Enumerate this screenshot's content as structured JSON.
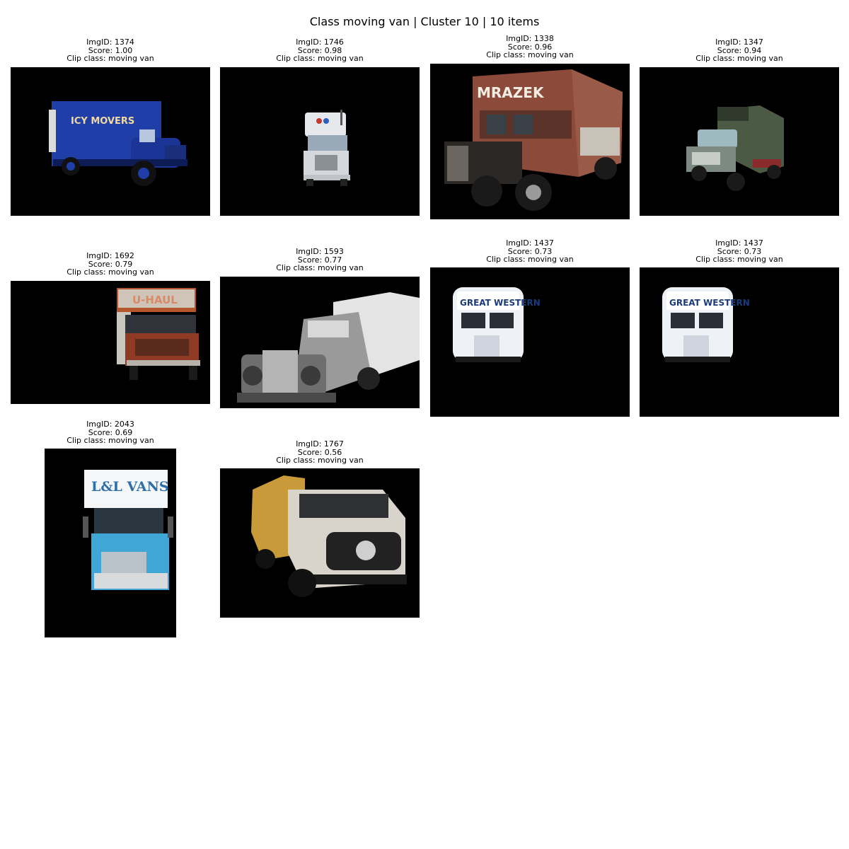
{
  "title": "Class moving van | Cluster 10 | 10 items",
  "items": [
    {
      "id_line": "ImgID: 1374",
      "score_line": "Score: 1.00",
      "class_line": "Clip class: moving van",
      "picture": "blue-moving-truck",
      "truck_text": "ICY MOVERS",
      "color": "#1f3ea8"
    },
    {
      "id_line": "ImgID: 1746",
      "score_line": "Score: 0.98",
      "class_line": "Clip class: moving van",
      "picture": "white-semi-truck-cab",
      "truck_text": "",
      "color": "#e6e8ec"
    },
    {
      "id_line": "ImgID: 1338",
      "score_line": "Score: 0.96",
      "class_line": "Clip class: moving van",
      "picture": "red-vintage-moving-truck",
      "truck_text": "MRAZEK",
      "color": "#8c4a3a"
    },
    {
      "id_line": "ImgID: 1347",
      "score_line": "Score: 0.94",
      "class_line": "Clip class: moving van",
      "picture": "green-vintage-truck",
      "truck_text": "",
      "color": "#4b5a45"
    },
    {
      "id_line": "ImgID: 1692",
      "score_line": "Score: 0.79",
      "class_line": "Clip class: moving van",
      "picture": "u-haul-truck",
      "truck_text": "U-HAUL",
      "color": "#b5552e"
    },
    {
      "id_line": "ImgID: 1593",
      "score_line": "Score: 0.77",
      "class_line": "Clip class: moving van",
      "picture": "grayscale-vintage-truck",
      "truck_text": "",
      "color": "#8a8a8a"
    },
    {
      "id_line": "ImgID: 1437",
      "score_line": "Score: 0.73",
      "class_line": "Clip class: moving van",
      "picture": "white-van-front",
      "truck_text": "GREAT WESTERN",
      "color": "#eef1f6"
    },
    {
      "id_line": "ImgID: 1437",
      "score_line": "Score: 0.73",
      "class_line": "Clip class: moving van",
      "picture": "white-van-front",
      "truck_text": "GREAT WESTERN",
      "color": "#eef1f6"
    },
    {
      "id_line": "ImgID: 2043",
      "score_line": "Score: 0.69",
      "class_line": "Clip class: moving van",
      "picture": "light-blue-box-truck",
      "truck_text": "L&L VANS",
      "color": "#3fa6d6"
    },
    {
      "id_line": "ImgID: 1767",
      "score_line": "Score: 0.56",
      "class_line": "Clip class: moving van",
      "picture": "mercedes-flatbed-truck",
      "truck_text": "",
      "color": "#d8d4cc"
    }
  ]
}
